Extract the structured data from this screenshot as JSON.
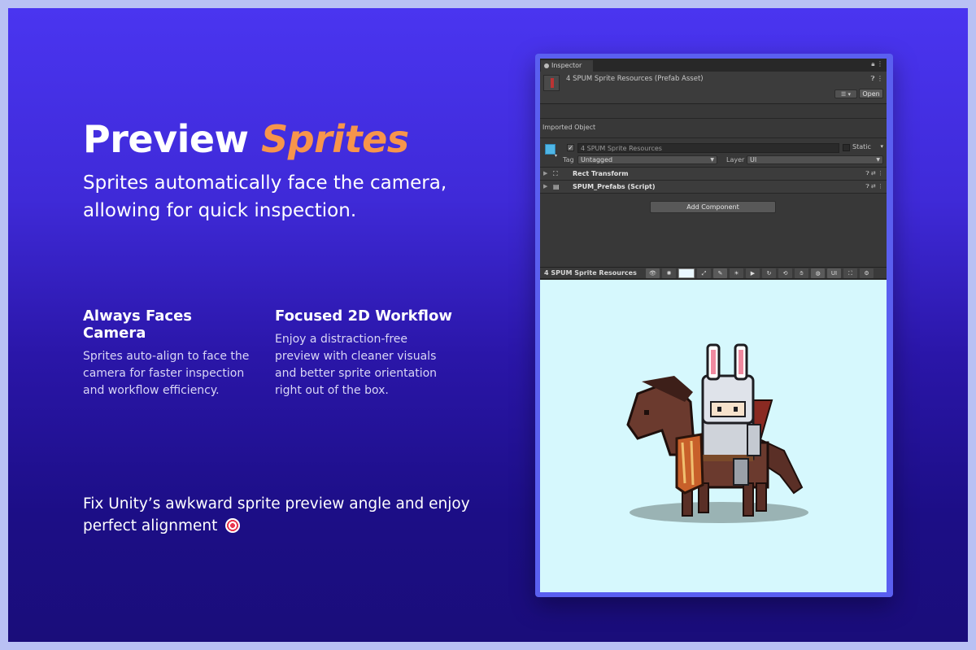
{
  "hero": {
    "title_plain": "Preview",
    "title_accent": "Sprites",
    "subtitle": "Sprites automatically face the camera, allowing for quick inspection."
  },
  "features": [
    {
      "title": "Always Faces Camera",
      "body": "Sprites auto-align to face the camera for faster inspection and workflow efficiency."
    },
    {
      "title": "Focused 2D Workflow",
      "body": "Enjoy a distraction-free preview with cleaner visuals and better sprite orientation right out of the box."
    }
  ],
  "footer": {
    "text": "Fix Unity’s awkward sprite preview angle and enjoy perfect alignment",
    "icon": "target-icon"
  },
  "inspector": {
    "tab_label": "Inspector",
    "asset_title": "4 SPUM Sprite Resources (Prefab Asset)",
    "open_label": "Open",
    "section_label": "Imported Object",
    "gameobject_name": "4 SPUM Sprite Resources",
    "static_label": "Static",
    "tag_label": "Tag",
    "tag_value": "Untagged",
    "layer_label": "Layer",
    "layer_value": "UI",
    "components": [
      {
        "label": "Rect Transform",
        "icon": "rect-transform-icon"
      },
      {
        "label": "SPUM_Prefabs (Script)",
        "icon": "script-icon"
      }
    ],
    "add_component_label": "Add Component",
    "preview_title": "4 SPUM Sprite Resources",
    "preview_toolbar_last": "UI"
  },
  "colors": {
    "accent": "#f7954b",
    "poster_bg_top": "#4a35f0",
    "poster_bg_bottom": "#1a0d7a",
    "frame": "#5a5ff0",
    "preview_bg": "#d6f8fd"
  }
}
